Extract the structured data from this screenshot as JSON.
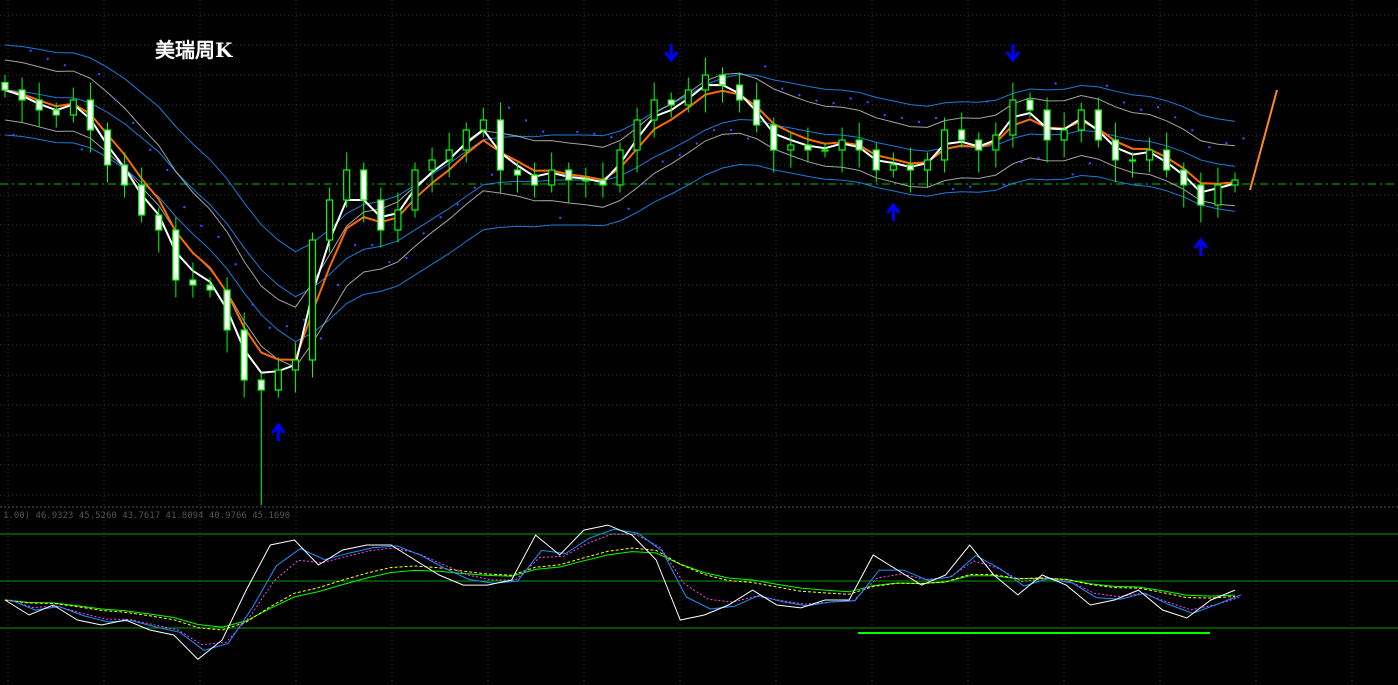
{
  "chart_data": {
    "type": "candlestick",
    "title": "美瑞周K",
    "ylim": [
      0,
      101
    ],
    "closes": [
      83,
      81,
      79,
      78,
      81,
      75,
      68,
      64,
      58,
      55,
      45,
      44,
      43,
      35,
      25,
      23,
      27,
      29,
      53,
      61,
      67,
      61,
      55,
      59,
      67,
      69,
      71,
      75,
      77,
      67,
      66,
      64,
      67,
      65,
      65,
      64,
      71,
      77,
      81,
      80,
      83,
      86,
      84,
      81,
      76,
      71,
      72,
      71,
      71,
      73,
      71,
      67,
      68,
      67,
      69,
      75,
      73,
      71,
      74,
      81,
      79,
      73,
      75,
      79,
      73,
      69,
      69,
      71,
      67,
      64,
      60,
      64,
      65
    ],
    "reference_level": 64.2,
    "signals": [
      {
        "type": "down-arrow",
        "bar": 39
      },
      {
        "type": "down-arrow",
        "bar": 59
      },
      {
        "type": "up-arrow",
        "bar": 16
      },
      {
        "type": "up-arrow",
        "bar": 52
      },
      {
        "type": "up-arrow",
        "bar": 70
      }
    ],
    "oscillator": {
      "label": "1.00) 46.9323 45.5260 43.7617 41.8094 40.9766 45.1690",
      "levels": [
        80,
        50,
        20
      ],
      "values": [
        37.9,
        28.3,
        34.7,
        25.1,
        21.9,
        25.1,
        18.7,
        15.5,
        0,
        12.3,
        44.2,
        73,
        76.2,
        60.2,
        69.8,
        73,
        73,
        63.4,
        53.8,
        47.4,
        47.4,
        50.6,
        79.3,
        66.6,
        82.5,
        85.7,
        79.3,
        63.4,
        25.1,
        28.3,
        34.7,
        44.2,
        34.7,
        32.8,
        37.9,
        37.9,
        66.6,
        57,
        47.4,
        53.8,
        73,
        53.8,
        41.1,
        53.8,
        47.4,
        34.7,
        37.9,
        44.2,
        31.5,
        26.4,
        37.9,
        44.2
      ]
    }
  },
  "colors": {
    "bull": "#00ff00",
    "bear": "#ffffff",
    "ma_fast": "#ffffff",
    "ma_orange": "#ff6a00",
    "band": "#c0c0c0",
    "band_blue": "#1e90ff",
    "arrow": "#0000ff",
    "reference": "#00c000",
    "grid": "#3a3a3a"
  }
}
